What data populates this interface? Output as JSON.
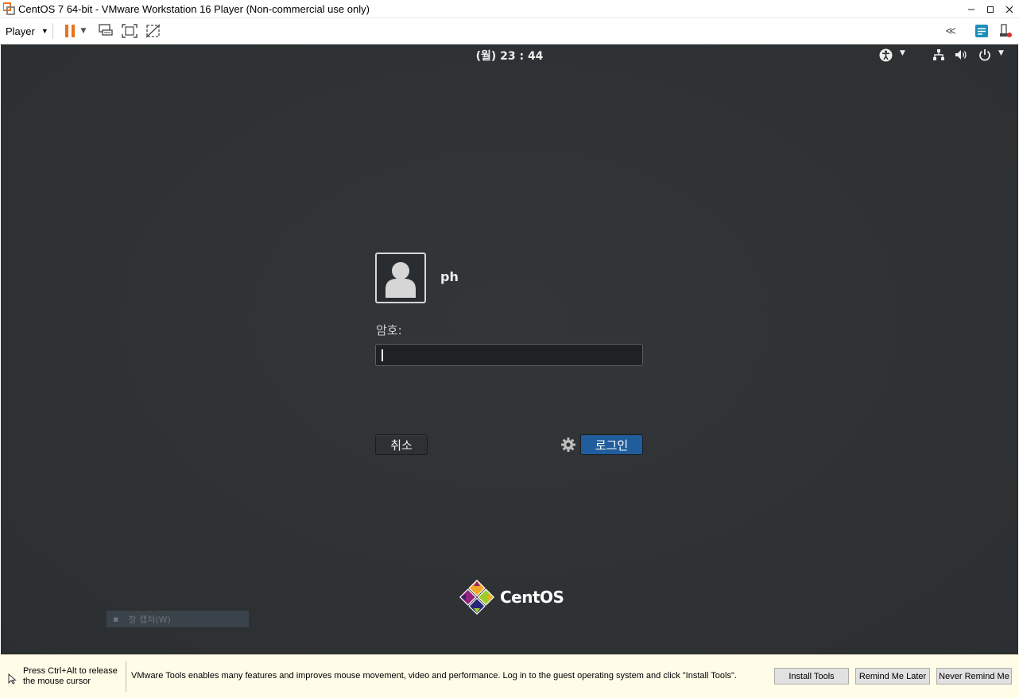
{
  "window": {
    "title": "CentOS 7 64-bit - VMware Workstation 16 Player (Non-commercial use only)",
    "controls": [
      "minimize",
      "maximize",
      "close"
    ]
  },
  "toolbar": {
    "player_label": "Player",
    "icons": [
      "pause-icon",
      "send-ctrl-alt-del-icon",
      "fit-guest-icon",
      "unity-icon",
      "collapse-toolbar-icon",
      "notes-icon",
      "devices-icon"
    ],
    "accent": "#e8731f"
  },
  "guest": {
    "clock": "(월) 23 : 44",
    "username": "ph",
    "password_label": "암호:",
    "password_value": "",
    "cancel_label": "취소",
    "login_label": "로그인",
    "logo_text": "CentOS",
    "ghost_capture_text": "창 캡처(W)",
    "colors": {
      "background": "#2e3133",
      "login_button": "#215d9c"
    }
  },
  "statusbar": {
    "release_line1": "Press Ctrl+Alt to release",
    "release_line2": "the mouse cursor",
    "message": "VMware Tools enables many features and improves mouse movement, video and performance. Log in to the guest operating system and click \"Install Tools\".",
    "install_label": "Install Tools",
    "remind_label": "Remind Me Later",
    "never_label": "Never Remind Me"
  }
}
